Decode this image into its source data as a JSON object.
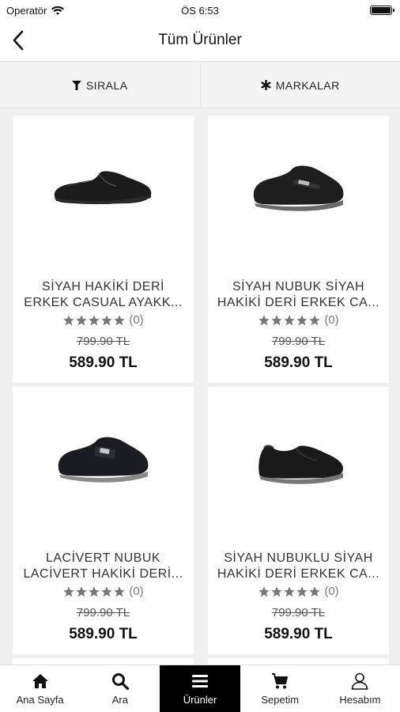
{
  "status": {
    "carrier": "Operatör",
    "time": "ÖS 6:53"
  },
  "nav": {
    "title": "Tüm Ürünler"
  },
  "filters": {
    "sort_label": "SIRALA",
    "brands_label": "MARKALAR"
  },
  "products": [
    {
      "name_line1": "SİYAH HAKİKİ DERİ",
      "name_line2": "ERKEK CASUAL AYAKK...",
      "rating_count": "(0)",
      "old_price": "799.90 TL",
      "price": "589.90 TL",
      "stars": 5
    },
    {
      "name_line1": "SİYAH NUBUK SİYAH",
      "name_line2": "HAKİKİ DERİ ERKEK CA...",
      "rating_count": "(0)",
      "old_price": "799.90 TL",
      "price": "589.90 TL",
      "stars": 5
    },
    {
      "name_line1": "LACİVERT NUBUK",
      "name_line2": "LACİVERT HAKİKİ DERİ...",
      "rating_count": "(0)",
      "old_price": "799.90 TL",
      "price": "589.90 TL",
      "stars": 5
    },
    {
      "name_line1": "SİYAH NUBUKLU SİYAH",
      "name_line2": "HAKİKİ DERİ ERKEK CA...",
      "rating_count": "(0)",
      "old_price": "799.90 TL",
      "price": "589.90 TL",
      "stars": 5
    }
  ],
  "tabs": [
    {
      "label": "Ana Sayfa",
      "icon": "home-icon"
    },
    {
      "label": "Ara",
      "icon": "search-icon"
    },
    {
      "label": "Ürünler",
      "icon": "menu-icon",
      "active": true
    },
    {
      "label": "Sepetim",
      "icon": "cart-icon"
    },
    {
      "label": "Hesabım",
      "icon": "user-icon"
    }
  ],
  "colors": {
    "active_tab_bg": "#000000",
    "background": "#f0f0f0",
    "card": "#ffffff"
  }
}
